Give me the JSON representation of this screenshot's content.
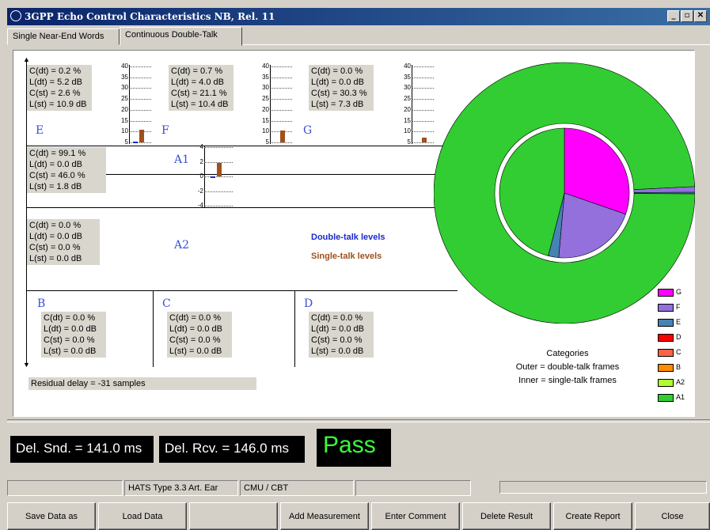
{
  "window": {
    "title": "3GPP Echo Control Characteristics NB, Rel. 11",
    "min": "_",
    "max": "▫",
    "close": "✕"
  },
  "tabs": [
    "Single Near-End Words",
    "Continuous Double-Talk"
  ],
  "zones": {
    "E": {
      "label": "E",
      "stats": [
        "C(dt) = 0.2 %",
        "L(dt) = 5.2 dB",
        "C(st) = 2.6 %",
        "L(st) = 10.9 dB"
      ],
      "ticks": [
        "40",
        "35",
        "30",
        "25",
        "20",
        "15",
        "10",
        "5"
      ],
      "st": 10.9,
      "dt": 5.2
    },
    "F": {
      "label": "F",
      "stats": [
        "C(dt) = 0.7 %",
        "L(dt) = 4.0 dB",
        "C(st) = 21.1 %",
        "L(st) = 10.4 dB"
      ],
      "ticks": [
        "40",
        "35",
        "30",
        "25",
        "20",
        "15",
        "10",
        "5"
      ],
      "st": 10.4,
      "dt": 4.0
    },
    "G": {
      "label": "G",
      "stats": [
        "C(dt) = 0.0 %",
        "L(dt) = 0.0 dB",
        "C(st) = 30.3 %",
        "L(st) = 7.3 dB"
      ],
      "ticks": [
        "40",
        "35",
        "30",
        "25",
        "20",
        "15",
        "10",
        "5"
      ],
      "st": 7.3,
      "dt": 0
    },
    "A1": {
      "label": "A1",
      "stats": [
        "C(dt) = 99.1 %",
        "L(dt) = 0.0 dB",
        "C(st) = 46.0 %",
        "L(st) = 1.8 dB"
      ],
      "ticks": [
        "4",
        "2",
        "0",
        "-2",
        "-4"
      ],
      "st": 1.8,
      "dt": 0
    },
    "A2": {
      "label": "A2",
      "stats": [
        "C(dt) = 0.0 %",
        "L(dt) = 0.0 dB",
        "C(st) = 0.0 %",
        "L(st) = 0.0 dB"
      ]
    },
    "B": {
      "label": "B",
      "stats": [
        "C(dt) = 0.0 %",
        "L(dt) = 0.0 dB",
        "C(st) = 0.0 %",
        "L(st) = 0.0 dB"
      ]
    },
    "C": {
      "label": "C",
      "stats": [
        "C(dt) = 0.0 %",
        "L(dt) = 0.0 dB",
        "C(st) = 0.0 %",
        "L(st) = 0.0 dB"
      ]
    },
    "D": {
      "label": "D",
      "stats": [
        "C(dt) = 0.0 %",
        "L(dt) = 0.0 dB",
        "C(st) = 0.0 %",
        "L(st) = 0.0 dB"
      ]
    }
  },
  "legend_levels": {
    "double": "Double-talk levels",
    "single": "Single-talk levels",
    "double_color": "#1a2acc",
    "single_color": "#a0501a"
  },
  "residual_delay": "Residual delay = -31 samples",
  "chart_data": {
    "type": "pie",
    "categories": [
      "G",
      "F",
      "E",
      "D",
      "C",
      "B",
      "A2",
      "A1"
    ],
    "colors": [
      "#ff00ff",
      "#9370db",
      "#4682b4",
      "#ff0000",
      "#ff6347",
      "#ff8c00",
      "#adff2f",
      "#32cd32"
    ],
    "series": [
      {
        "name": "Outer = double-talk frames",
        "values": [
          0,
          0.7,
          0.2,
          0,
          0,
          0,
          0,
          99.1
        ]
      },
      {
        "name": "Inner = single-talk frames",
        "values": [
          30.3,
          21.1,
          2.6,
          0,
          0,
          0,
          0,
          46.0
        ]
      }
    ],
    "legend_title": "Categories",
    "legend_outer": "Outer = double-talk frames",
    "legend_inner": "Inner = single-talk frames"
  },
  "delays": {
    "send": "Del. Snd. = 141.0 ms",
    "receive": "Del. Rcv. = 146.0 ms"
  },
  "result": "Pass",
  "status": [
    "",
    "HATS Type 3.3 Art. Ear",
    "CMU / CBT",
    "",
    ""
  ],
  "buttons": {
    "save": "Save Data as",
    "load": "Load Data",
    "blank": "",
    "add": "Add Measurement",
    "comment": "Enter Comment",
    "delete": "Delete Result",
    "report": "Create Report",
    "close": "Close"
  }
}
